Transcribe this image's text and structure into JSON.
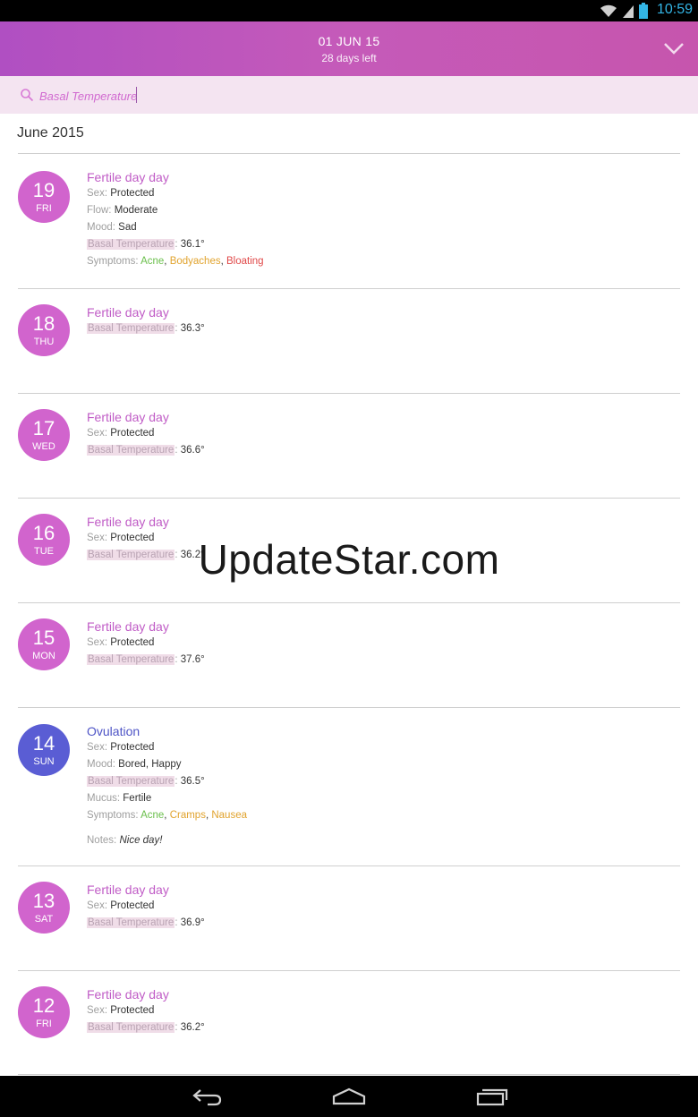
{
  "status_bar": {
    "time": "10:59",
    "icons": [
      "wifi-icon",
      "signal-icon",
      "battery-icon"
    ]
  },
  "header": {
    "date": "01 JUN 15",
    "days_left": "28 days left",
    "dropdown_icon": "chevron-down-icon"
  },
  "search": {
    "value": "Basal Temperature",
    "icon": "search-icon"
  },
  "month_label": "June 2015",
  "watermark": "UpdateStar.com",
  "labels": {
    "sex": "Sex:",
    "flow": "Flow:",
    "mood": "Mood:",
    "bbt": "Basal Temperature",
    "colon": ":",
    "symptoms": "Symptoms:",
    "mucus": "Mucus:",
    "notes": "Notes:"
  },
  "entries": [
    {
      "day": "19",
      "dow": "FRI",
      "title": "Fertile day day",
      "sex": "Protected",
      "flow": "Moderate",
      "mood": "Sad",
      "bbt": "36.1°",
      "symptoms": [
        {
          "text": "Acne",
          "sep": ", "
        },
        {
          "text": "Bodyaches",
          "sep": ", "
        },
        {
          "text": "Bloating",
          "sep": ""
        }
      ]
    },
    {
      "day": "18",
      "dow": "THU",
      "title": "Fertile day day",
      "bbt": "36.3°"
    },
    {
      "day": "17",
      "dow": "WED",
      "title": "Fertile day day",
      "sex": "Protected",
      "bbt": "36.6°"
    },
    {
      "day": "16",
      "dow": "TUE",
      "title": "Fertile day day",
      "sex": "Protected",
      "bbt": "36.2°"
    },
    {
      "day": "15",
      "dow": "MON",
      "title": "Fertile day day",
      "sex": "Protected",
      "bbt": "37.6°"
    },
    {
      "day": "14",
      "dow": "SUN",
      "title": "Ovulation",
      "sex": "Protected",
      "mood": "Bored, Happy",
      "bbt": "36.5°",
      "mucus": "Fertile",
      "symptoms": [
        {
          "text": "Acne",
          "sep": ", "
        },
        {
          "text": "Cramps",
          "sep": ", "
        },
        {
          "text": "Nausea",
          "sep": ""
        }
      ],
      "notes": "Nice day!"
    },
    {
      "day": "13",
      "dow": "SAT",
      "title": "Fertile day day",
      "sex": "Protected",
      "bbt": "36.9°"
    },
    {
      "day": "12",
      "dow": "FRI",
      "title": "Fertile day day",
      "sex": "Protected",
      "bbt": "36.2°"
    }
  ],
  "symptom_colors": {
    "Acne": "#6abf4b",
    "Bodyaches": "#e1a32d",
    "Bloating": "#e04848",
    "Cramps": "#e1a32d",
    "Nausea": "#e1a32d"
  },
  "colors": {
    "accent": "#c05cc6",
    "ovulation": "#5a5dd4"
  },
  "nav": {
    "back_icon": "back-icon",
    "home_icon": "home-icon",
    "recents_icon": "recents-icon"
  }
}
